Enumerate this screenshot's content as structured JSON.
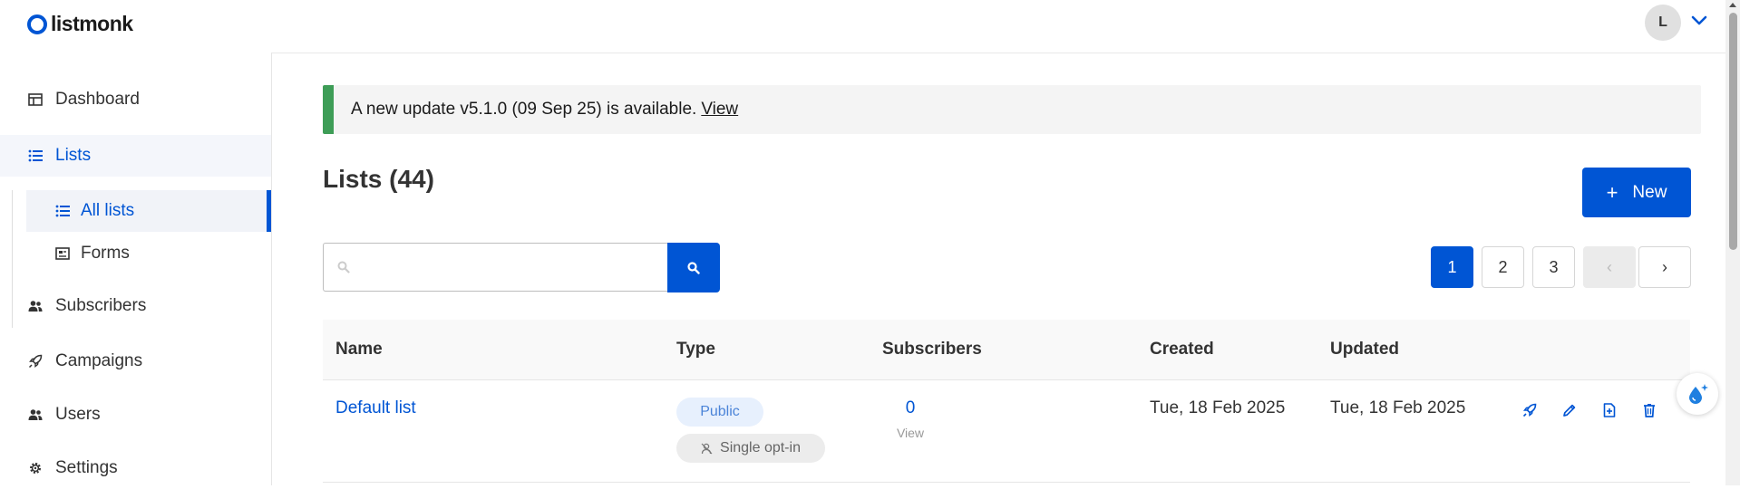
{
  "brand": {
    "name": "listmonk"
  },
  "user": {
    "initial": "L"
  },
  "sidebar": {
    "items": [
      {
        "label": "Dashboard",
        "icon": "dashboard-icon"
      },
      {
        "label": "Lists",
        "icon": "list-icon"
      },
      {
        "label": "Subscribers",
        "icon": "users-icon"
      },
      {
        "label": "Campaigns",
        "icon": "rocket-icon"
      },
      {
        "label": "Users",
        "icon": "users-icon"
      },
      {
        "label": "Settings",
        "icon": "gear-icon"
      }
    ],
    "lists_submenu": [
      {
        "label": "All lists",
        "icon": "list-icon"
      },
      {
        "label": "Forms",
        "icon": "form-icon"
      }
    ]
  },
  "notice": {
    "text": "A new update v5.1.0 (09 Sep 25) is available.",
    "link": "View"
  },
  "page": {
    "title": "Lists (44)",
    "new_button": "New",
    "new_icon": "+"
  },
  "search": {
    "placeholder": "",
    "value": ""
  },
  "pagination": {
    "pages": [
      "1",
      "2",
      "3"
    ],
    "current": "1",
    "prev": "‹",
    "next": "›"
  },
  "table": {
    "columns": [
      "Name",
      "Type",
      "Subscribers",
      "Created",
      "Updated"
    ],
    "rows": [
      {
        "name": "Default list",
        "type": "Public",
        "optin": "Single opt-in",
        "subscribers": "0",
        "subscribers_link": "View",
        "created": "Tue, 18 Feb 2025",
        "updated": "Tue, 18 Feb 2025"
      }
    ]
  },
  "colors": {
    "primary": "#0055d4",
    "notice_accent": "#3e9d57"
  }
}
